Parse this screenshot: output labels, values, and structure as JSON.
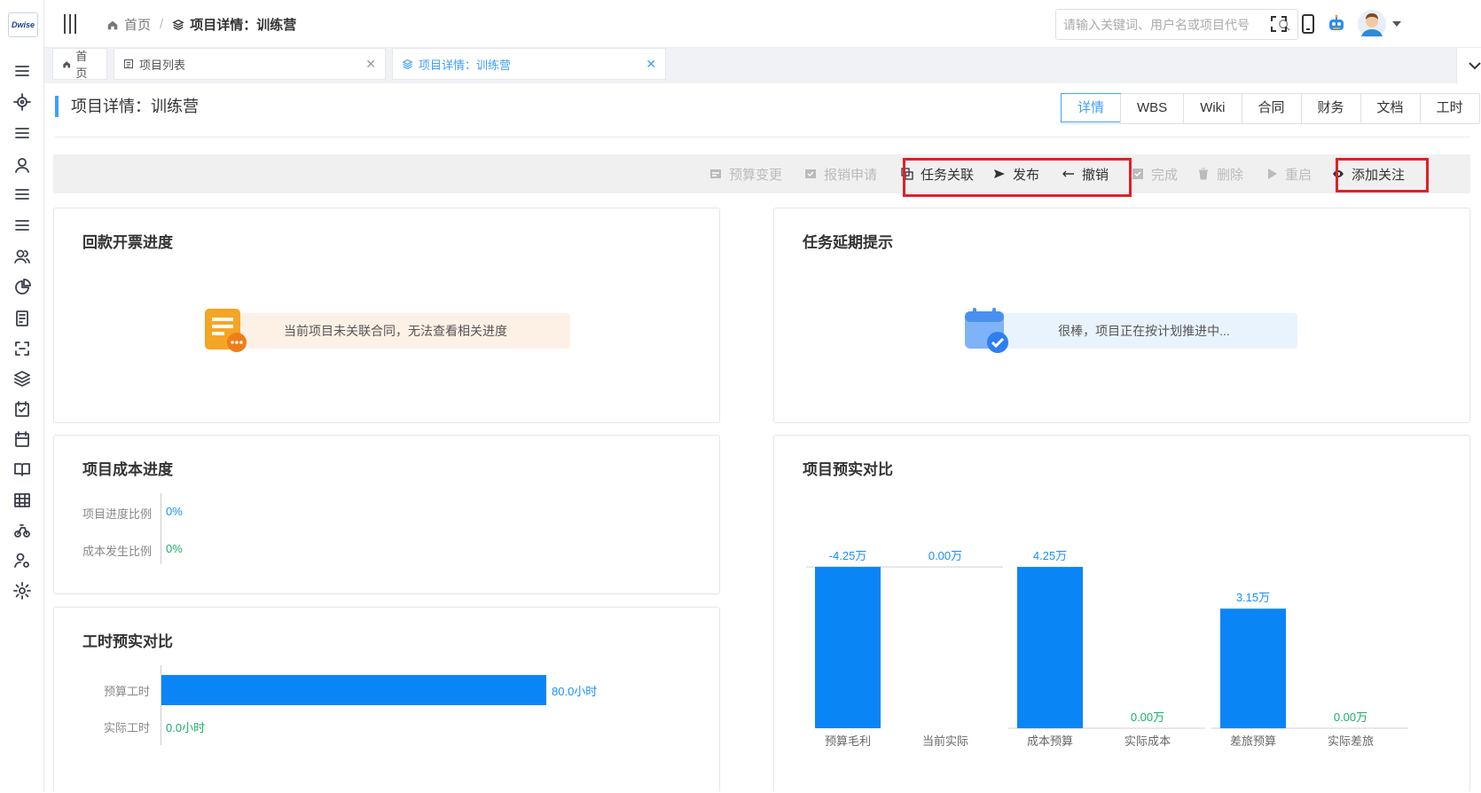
{
  "app": {
    "logo_text": "Dwise"
  },
  "sidebar": {
    "icons": [
      "menu-icon",
      "target-icon",
      "list-icon",
      "user-icon",
      "list-icon",
      "list-icon",
      "users-icon",
      "pie-chart-icon",
      "report-icon",
      "scan-icon",
      "layers-icon",
      "calendar-check-icon",
      "calendar-icon",
      "book-icon",
      "table-icon",
      "bike-icon",
      "user-settings-icon",
      "gear-icon"
    ]
  },
  "header": {
    "breadcrumb": {
      "home": "首页",
      "current": "项目详情：训练营"
    },
    "search": {
      "placeholder": "请输入关键词、用户名或项目代号"
    }
  },
  "tabs": [
    {
      "label": "首页"
    },
    {
      "label": "项目列表"
    },
    {
      "label": "项目详情：训练营"
    }
  ],
  "page": {
    "title": "项目详情：训练营",
    "view_tabs": [
      "详情",
      "WBS",
      "Wiki",
      "合同",
      "财务",
      "文档",
      "工时"
    ],
    "actions": {
      "budget_change": "预算变更",
      "reimburse": "报销申请",
      "task_link": "任务关联",
      "publish": "发布",
      "revoke": "撤销",
      "complete": "完成",
      "delete": "删除",
      "restart": "重启",
      "follow": "添加关注"
    }
  },
  "cards": {
    "payment": {
      "title": "回款开票进度",
      "message": "当前项目未关联合同，无法查看相关进度"
    },
    "delay": {
      "title": "任务延期提示",
      "message": "很棒，项目正在按计划推进中..."
    },
    "cost": {
      "title": "项目成本进度",
      "rows": [
        {
          "label": "项目进度比例",
          "value": "0%"
        },
        {
          "label": "成本发生比例",
          "value": "0%"
        }
      ]
    },
    "hours": {
      "title": "工时预实对比",
      "rows": [
        {
          "label": "预算工时",
          "value": "80.0小时",
          "fraction": 1.0
        },
        {
          "label": "实际工时",
          "value": "0.0小时",
          "fraction": 0
        }
      ]
    },
    "budget_actual": {
      "title": "项目预实对比"
    }
  },
  "chart_data": {
    "type": "bar",
    "title": "项目预实对比",
    "groups": [
      {
        "bars": [
          {
            "label": "预算毛利",
            "value": -4.25,
            "display": "-4.25万"
          },
          {
            "label": "当前实际",
            "value": 0.0,
            "display": "0.00万"
          }
        ]
      },
      {
        "bars": [
          {
            "label": "成本预算",
            "value": 4.25,
            "display": "4.25万"
          },
          {
            "label": "实际成本",
            "value": 0.0,
            "display": "0.00万"
          }
        ]
      },
      {
        "bars": [
          {
            "label": "差旅预算",
            "value": 3.15,
            "display": "3.15万"
          },
          {
            "label": "实际差旅",
            "value": 0.0,
            "display": "0.00万"
          }
        ]
      }
    ],
    "unit": "万",
    "colors": {
      "bar": "#0a85f5",
      "label_blue": "#1890ff",
      "label_green": "#1aad69"
    }
  }
}
